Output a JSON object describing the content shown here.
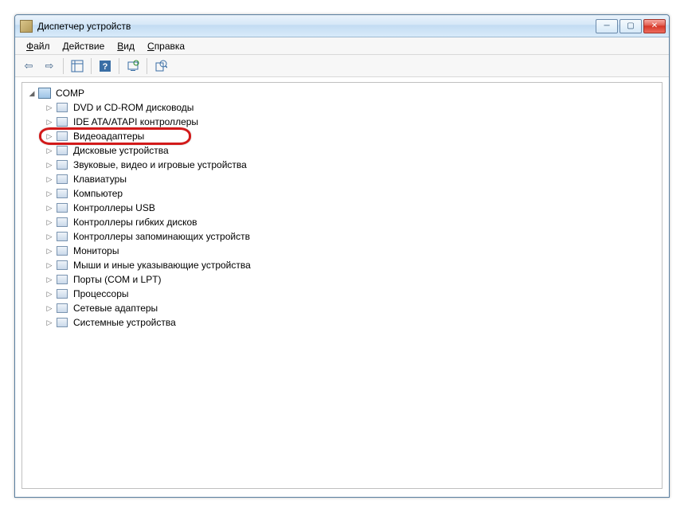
{
  "window": {
    "title": "Диспетчер устройств"
  },
  "menu": {
    "file": "Файл",
    "action": "Действие",
    "view": "Вид",
    "help": "Справка"
  },
  "tree": {
    "root": "COMP",
    "items": [
      "DVD и CD-ROM дисководы",
      "IDE ATA/ATAPI контроллеры",
      "Видеоадаптеры",
      "Дисковые устройства",
      "Звуковые, видео и игровые устройства",
      "Клавиатуры",
      "Компьютер",
      "Контроллеры USB",
      "Контроллеры гибких дисков",
      "Контроллеры запоминающих устройств",
      "Мониторы",
      "Мыши и иные указывающие устройства",
      "Порты (COM и LPT)",
      "Процессоры",
      "Сетевые адаптеры",
      "Системные устройства"
    ]
  },
  "highlight_index": 2
}
